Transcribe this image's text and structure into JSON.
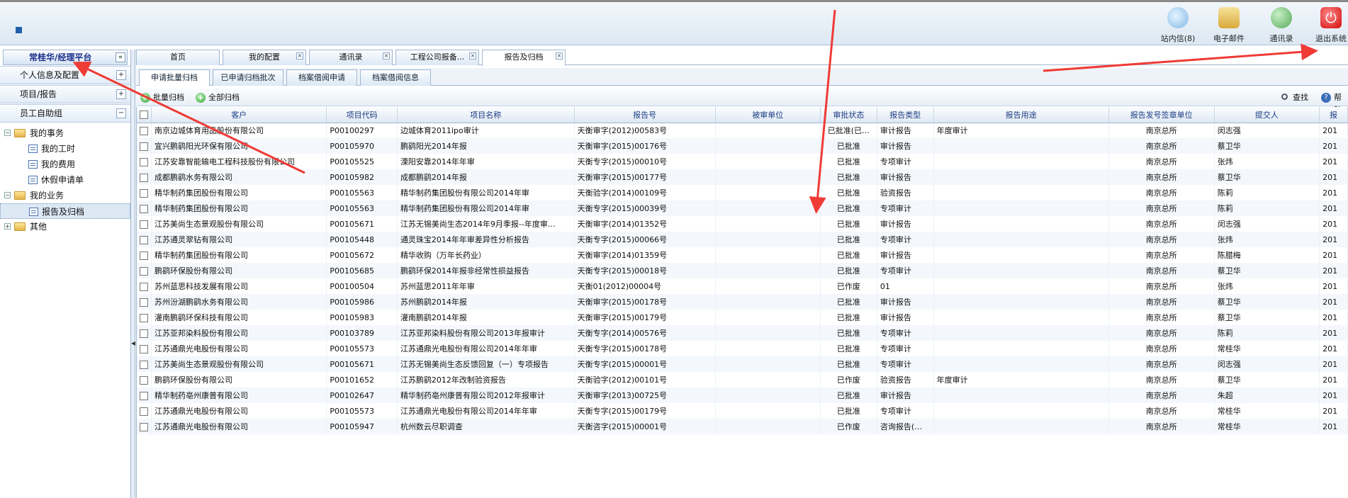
{
  "header": {
    "toolbar": [
      {
        "label": "站内信(8)",
        "icon": "message-icon"
      },
      {
        "label": "电子邮件",
        "icon": "email-icon"
      },
      {
        "label": "通讯录",
        "icon": "contacts-icon"
      },
      {
        "label": "退出系统",
        "icon": "power-icon"
      }
    ]
  },
  "sidebar": {
    "title": "常桂华/经理平台",
    "collapse_glyph": "«",
    "sections": [
      {
        "label": "个人信息及配置",
        "toggle": "+"
      },
      {
        "label": "项目/报告",
        "toggle": "+"
      },
      {
        "label": "员工自助组",
        "toggle": "−"
      }
    ],
    "tree": {
      "my_affairs": "我的事务",
      "my_hours": "我的工时",
      "my_expenses": "我的费用",
      "leave_request": "休假申请单",
      "my_business": "我的业务",
      "report_archive": "报告及归档",
      "other": "其他"
    }
  },
  "tabs": [
    {
      "label": "首页",
      "closable": false
    },
    {
      "label": "我的配置",
      "closable": true
    },
    {
      "label": "通讯录",
      "closable": true
    },
    {
      "label": "工程公司报备...",
      "closable": true
    },
    {
      "label": "报告及归档",
      "closable": true
    }
  ],
  "subtabs": [
    "申请批量归档",
    "已申请归档批次",
    "档案借阅申请",
    "档案借阅信息"
  ],
  "toolbar": {
    "batch_archive": "批量归档",
    "archive_all": "全部归档",
    "search": "查找",
    "help": "帮助"
  },
  "grid": {
    "columns": [
      "客户",
      "项目代码",
      "项目名称",
      "报告号",
      "被审单位",
      "审批状态",
      "报告类型",
      "报告用途",
      "报告发号签章单位",
      "提交人",
      "报"
    ],
    "rows": [
      [
        "南京边城体育用品股份有限公司",
        "P00100297",
        "边城体育2011ipo审计",
        "天衡审字(2012)00583号",
        "",
        "已批准(已…",
        "审计报告",
        "年度审计",
        "南京总所",
        "闵志强",
        "201"
      ],
      [
        "宜兴鹏鹞阳光环保有限公司",
        "P00105970",
        "鹏鹞阳光2014年报",
        "天衡审字(2015)00176号",
        "",
        "已批准",
        "审计报告",
        "",
        "南京总所",
        "蔡卫华",
        "201"
      ],
      [
        "江苏安靠智能输电工程科技股份有限公司",
        "P00105525",
        "溧阳安靠2014年年审",
        "天衡专字(2015)00010号",
        "",
        "已批准",
        "专项审计",
        "",
        "南京总所",
        "张炜",
        "201"
      ],
      [
        "成都鹏鹞水务有限公司",
        "P00105982",
        "成都鹏鹞2014年报",
        "天衡审字(2015)00177号",
        "",
        "已批准",
        "审计报告",
        "",
        "南京总所",
        "蔡卫华",
        "201"
      ],
      [
        "精华制药集团股份有限公司",
        "P00105563",
        "精华制药集团股份有限公司2014年审",
        "天衡验字(2014)00109号",
        "",
        "已批准",
        "验资报告",
        "",
        "南京总所",
        "陈莉",
        "201"
      ],
      [
        "精华制药集团股份有限公司",
        "P00105563",
        "精华制药集团股份有限公司2014年审",
        "天衡专字(2015)00039号",
        "",
        "已批准",
        "专项审计",
        "",
        "南京总所",
        "陈莉",
        "201"
      ],
      [
        "江苏美尚生态景观股份有限公司",
        "P00105671",
        "江苏无锡美尚生态2014年9月季报--年度审…",
        "天衡审字(2014)01352号",
        "",
        "已批准",
        "审计报告",
        "",
        "南京总所",
        "闵志强",
        "201"
      ],
      [
        "江苏通灵翠钻有限公司",
        "P00105448",
        "通灵珠宝2014年年审差异性分析报告",
        "天衡专字(2015)00066号",
        "",
        "已批准",
        "专项审计",
        "",
        "南京总所",
        "张炜",
        "201"
      ],
      [
        "精华制药集团股份有限公司",
        "P00105672",
        "精华收购（万年长药业）",
        "天衡审字(2014)01359号",
        "",
        "已批准",
        "审计报告",
        "",
        "南京总所",
        "陈腊梅",
        "201"
      ],
      [
        "鹏鹞环保股份有限公司",
        "P00105685",
        "鹏鹞环保2014年报非经常性损益报告",
        "天衡专字(2015)00018号",
        "",
        "已批准",
        "专项审计",
        "",
        "南京总所",
        "蔡卫华",
        "201"
      ],
      [
        "苏州蓝思科技发展有限公司",
        "P00100504",
        "苏州蓝思2011年年审",
        "天衡01(2012)00004号",
        "",
        "已作废",
        "01",
        "",
        "南京总所",
        "张炜",
        "201"
      ],
      [
        "苏州汾湖鹏鹞水务有限公司",
        "P00105986",
        "苏州鹏鹞2014年报",
        "天衡审字(2015)00178号",
        "",
        "已批准",
        "审计报告",
        "",
        "南京总所",
        "蔡卫华",
        "201"
      ],
      [
        "灌南鹏鹞环保科技有限公司",
        "P00105983",
        "灌南鹏鹞2014年报",
        "天衡审字(2015)00179号",
        "",
        "已批准",
        "审计报告",
        "",
        "南京总所",
        "蔡卫华",
        "201"
      ],
      [
        "江苏亚邦染料股份有限公司",
        "P00103789",
        "江苏亚邦染料股份有限公司2013年报审计",
        "天衡专字(2014)00576号",
        "",
        "已批准",
        "专项审计",
        "",
        "南京总所",
        "陈莉",
        "201"
      ],
      [
        "江苏通鼎光电股份有限公司",
        "P00105573",
        "江苏通鼎光电股份有限公司2014年年审",
        "天衡专字(2015)00178号",
        "",
        "已批准",
        "专项审计",
        "",
        "南京总所",
        "常桂华",
        "201"
      ],
      [
        "江苏美尚生态景观股份有限公司",
        "P00105671",
        "江苏无锡美尚生态反馈回复（一）专项报告",
        "天衡专字(2015)00001号",
        "",
        "已批准",
        "专项审计",
        "",
        "南京总所",
        "闵志强",
        "201"
      ],
      [
        "鹏鹞环保股份有限公司",
        "P00101652",
        "江苏鹏鹞2012年改制验资报告",
        "天衡验字(2012)00101号",
        "",
        "已作废",
        "验资报告",
        "年度审计",
        "南京总所",
        "蔡卫华",
        "201"
      ],
      [
        "精华制药亳州康普有限公司",
        "P00102647",
        "精华制药亳州康普有限公司2012年报审计",
        "天衡审字(2013)00725号",
        "",
        "已批准",
        "审计报告",
        "",
        "南京总所",
        "朱超",
        "201"
      ],
      [
        "江苏通鼎光电股份有限公司",
        "P00105573",
        "江苏通鼎光电股份有限公司2014年年审",
        "天衡专字(2015)00179号",
        "",
        "已批准",
        "专项审计",
        "",
        "南京总所",
        "常桂华",
        "201"
      ],
      [
        "江苏通鼎光电股份有限公司",
        "P00105947",
        "杭州数云尽职调查",
        "天衡咨字(2015)00001号",
        "",
        "已作废",
        "咨询报告(…",
        "",
        "南京总所",
        "常桂华",
        "201"
      ]
    ]
  },
  "colors": {
    "accent": "#1a3b82",
    "annotation_arrow": "#ef3b36"
  }
}
